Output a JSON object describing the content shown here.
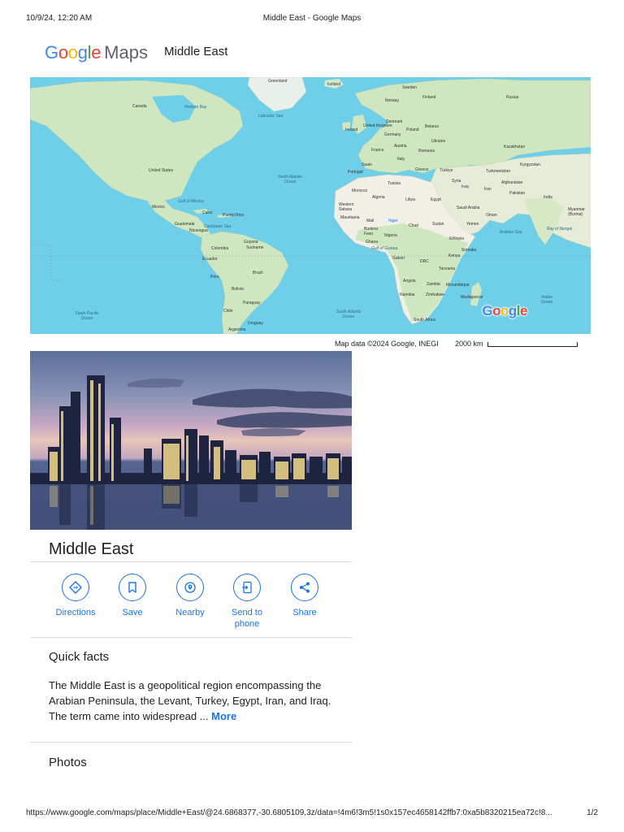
{
  "print": {
    "timestamp": "10/9/24, 12:20 AM",
    "doc_title": "Middle East - Google Maps",
    "url": "https://www.google.com/maps/place/Middle+East/@24.6868377,-30.6805109,3z/data=!4m6!3m5!1s0x157ec4658142ffb7:0xa5b8320215ea72c!8...",
    "page": "1/2"
  },
  "brand": {
    "google": [
      "G",
      "o",
      "o",
      "g",
      "l",
      "e"
    ],
    "maps": "Maps"
  },
  "header": {
    "place": "Middle East"
  },
  "colors": {
    "accent": "#1a73e8",
    "water": "#6fcfe8",
    "land": "#cfe7c0",
    "desert": "#f2efe6"
  },
  "map": {
    "watermark": "Google",
    "attribution": "Map data ©2024 Google, INEGI",
    "scale": "2000 km",
    "labels": {
      "greenland": "Greenland",
      "iceland": "Iceland",
      "canada": "Canada",
      "hudson": "Hudson Bay",
      "labrador": "Labrador Sea",
      "us": "United States",
      "mexico": "Mexico",
      "gulf": "Gulf of Mexico",
      "cuba": "Cuba",
      "guatemala": "Guatemala",
      "nicaragua": "Nicaragua",
      "caribbean": "Caribbean Sea",
      "puerto": "Puerto Rico",
      "colombia": "Colombia",
      "guyana": "Guyana",
      "suriname": "Suriname",
      "ecuador": "Ecuador",
      "peru": "Peru",
      "brazil": "Brazil",
      "bolivia": "Bolivia",
      "paraguay": "Paraguay",
      "chile": "Chile",
      "uruguay": "Uruguay",
      "argentina": "Argentina",
      "natl": "North Atlantic Ocean",
      "satl": "South Atlantic Ocean",
      "spac": "South Pacific Ocean",
      "norway": "Norway",
      "sweden": "Sweden",
      "finland": "Finland",
      "russia": "Russia",
      "uk": "United Kingdom",
      "ireland": "Ireland",
      "denmark": "Denmark",
      "germany": "Germany",
      "poland": "Poland",
      "belarus": "Belarus",
      "ukraine": "Ukraine",
      "france": "France",
      "austria": "Austria",
      "romania": "Romania",
      "italy": "Italy",
      "spain": "Spain",
      "portugal": "Portugal",
      "greece": "Greece",
      "turkiye": "Türkiye",
      "kazakhstan": "Kazakhstan",
      "kyrgyzstan": "Kyrgyzstan",
      "turkmenistan": "Turkmenistan",
      "syria": "Syria",
      "iraq": "Iraq",
      "iran": "Iran",
      "afghanistan": "Afghanistan",
      "pakistan": "Pakistan",
      "india": "India",
      "myanmar": "Myanmar (Burma)",
      "morocco": "Morocco",
      "algeria": "Algeria",
      "tunisia": "Tunisia",
      "libya": "Libya",
      "egypt": "Egypt",
      "wsahara": "Western Sahara",
      "mauritania": "Mauritania",
      "mali": "Mali",
      "niger": "Niger",
      "chad": "Chad",
      "sudan": "Sudan",
      "saudi": "Saudi Arabia",
      "oman": "Oman",
      "yemen": "Yemen",
      "burkina": "Burkina Faso",
      "nigeria": "Nigeria",
      "ghana": "Ghana",
      "ethiopia": "Ethiopia",
      "somalia": "Somalia",
      "kenya": "Kenya",
      "gabon": "Gabon",
      "drc": "DRC",
      "tanzania": "Tanzania",
      "gguinea": "Gulf of Guinea",
      "arabian": "Arabian Sea",
      "bengal": "Bay of Bengal",
      "angola": "Angola",
      "zambia": "Zambia",
      "mozambique": "Mozambique",
      "namibia": "Namibia",
      "zimbabwe": "Zimbabwe",
      "madagascar": "Madagascar",
      "safrica": "South Africa",
      "indian": "Indian Ocean"
    }
  },
  "place": {
    "title": "Middle East",
    "actions": [
      {
        "label": "Directions"
      },
      {
        "label": "Save"
      },
      {
        "label": "Nearby"
      },
      {
        "label": "Send to phone"
      },
      {
        "label": "Share"
      }
    ],
    "quick_facts": {
      "heading": "Quick facts",
      "text": "The Middle East is a geopolitical region encompassing the Arabian Peninsula, the Levant, Turkey, Egypt, Iran, and Iraq. The term came into widespread ...",
      "more": "More"
    },
    "photos_heading": "Photos"
  }
}
